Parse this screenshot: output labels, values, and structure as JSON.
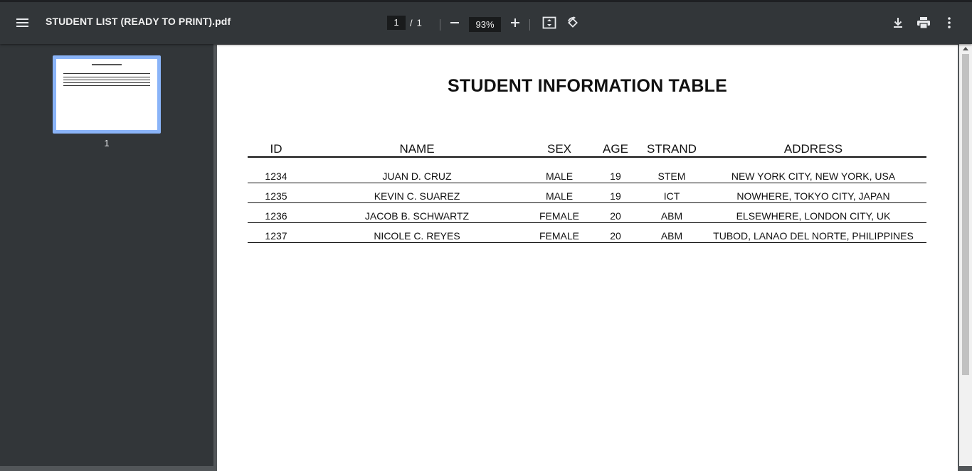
{
  "toolbar": {
    "menu_icon": "hamburger-menu-icon",
    "file_title": "STUDENT LIST (READY TO PRINT).pdf",
    "current_page": "1",
    "page_separator": "/",
    "total_pages": "1",
    "zoom_level": "93%",
    "icons": [
      "zoom-out-icon",
      "zoom-in-icon",
      "fit-to-page-icon",
      "rotate-icon",
      "download-icon",
      "print-icon",
      "more-vert-icon"
    ]
  },
  "sidebar": {
    "thumbnail_page_number": "1"
  },
  "document": {
    "title": "STUDENT INFORMATION TABLE",
    "columns": [
      "ID",
      "NAME",
      "SEX",
      "AGE",
      "STRAND",
      "ADDRESS"
    ],
    "rows": [
      [
        "1234",
        "JUAN D. CRUZ",
        "MALE",
        "19",
        "STEM",
        "NEW YORK CITY, NEW YORK, USA"
      ],
      [
        "1235",
        "KEVIN C. SUAREZ",
        "MALE",
        "19",
        "ICT",
        "NOWHERE, TOKYO CITY, JAPAN"
      ],
      [
        "1236",
        "JACOB B. SCHWARTZ",
        "FEMALE",
        "20",
        "ABM",
        "ELSEWHERE, LONDON CITY, UK"
      ],
      [
        "1237",
        "NICOLE C. REYES",
        "FEMALE",
        "20",
        "ABM",
        "TUBOD, LANAO DEL NORTE, PHILIPPINES"
      ]
    ]
  },
  "colors": {
    "toolbar_bg": "#323639",
    "viewer_bg": "#525659",
    "thumb_highlight": "#8ab4f8"
  }
}
